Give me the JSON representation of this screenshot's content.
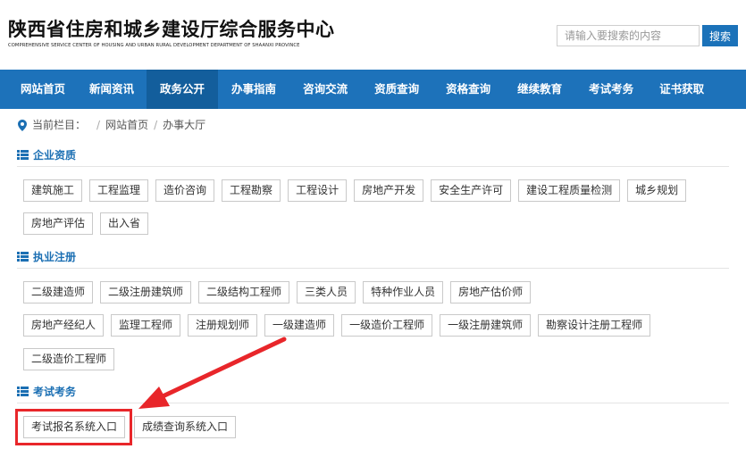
{
  "header": {
    "title": "陕西省住房和城乡建设厅综合服务中心",
    "subtitle": "COMPREHENSIVE SERVICE CENTER OF HOUSING AND URBAN RURAL DEVELOPMENT DEPARTMENT OF SHAANXI PROVINCE",
    "search_placeholder": "请输入要搜索的内容",
    "search_button": "搜索"
  },
  "nav": {
    "items": [
      "网站首页",
      "新闻资讯",
      "政务公开",
      "办事指南",
      "咨询交流",
      "资质查询",
      "资格查询",
      "继续教育",
      "考试考务",
      "证书获取"
    ],
    "active": "政务公开"
  },
  "breadcrumb": {
    "label": "当前栏目：",
    "items": [
      "网站首页",
      "办事大厅"
    ]
  },
  "sections": [
    {
      "title": "企业资质",
      "rows": [
        [
          "建筑施工",
          "工程监理",
          "造价咨询",
          "工程勘察",
          "工程设计",
          "房地产开发",
          "安全生产许可",
          "建设工程质量检测",
          "城乡规划"
        ],
        [
          "房地产评估",
          "出入省"
        ]
      ]
    },
    {
      "title": "执业注册",
      "rows": [
        [
          "二级建造师",
          "二级注册建筑师",
          "二级结构工程师",
          "三类人员",
          "特种作业人员",
          "房地产估价师"
        ],
        [
          "房地产经纪人",
          "监理工程师",
          "注册规划师",
          "一级建造师",
          "一级造价工程师",
          "一级注册建筑师",
          "勘察设计注册工程师"
        ],
        [
          "二级造价工程师"
        ]
      ]
    },
    {
      "title": "考试考务",
      "rows": [
        [
          "考试报名系统入口",
          "成绩查询系统入口"
        ]
      ]
    }
  ],
  "colors": {
    "nav_bg": "#1d72ba",
    "nav_active": "#135e9c",
    "section_title": "#1b6fb3",
    "highlight": "#e8262a"
  }
}
